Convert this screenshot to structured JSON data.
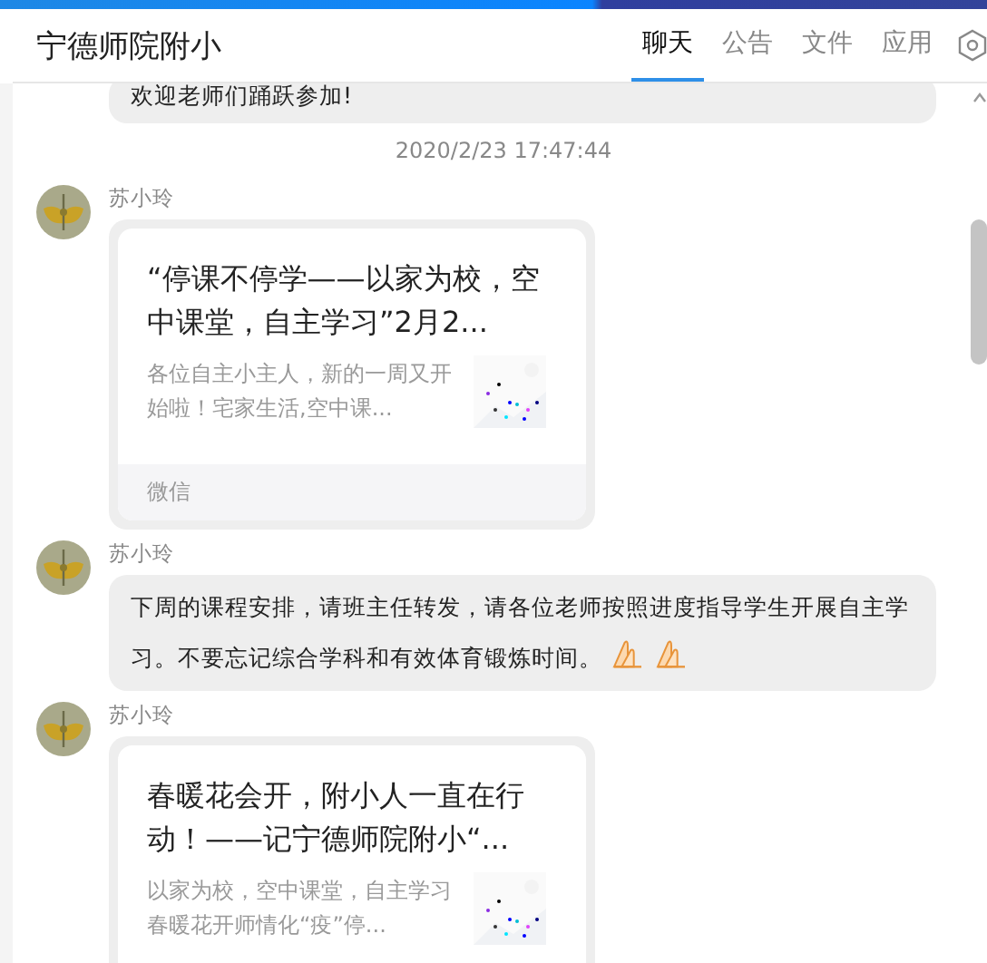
{
  "header": {
    "title": "宁德师院附小",
    "tabs": [
      {
        "label": "聊天",
        "selected": true
      },
      {
        "label": "公告",
        "selected": false
      },
      {
        "label": "文件",
        "selected": false
      },
      {
        "label": "应用",
        "selected": false
      }
    ]
  },
  "messages": [
    {
      "kind": "text",
      "text": "欢迎老师们踊跃参加!"
    },
    {
      "kind": "time",
      "text": "2020/2/23 17:47:44"
    },
    {
      "kind": "card",
      "sender": "苏小玲",
      "title": "“停课不停学——以家为校，空中课堂，自主学习”2月2...",
      "description": "各位自主小主人，新的一周又开始啦！宅家生活,空中课...",
      "source": "微信"
    },
    {
      "kind": "text",
      "sender": "苏小玲",
      "text": "下周的课程安排，请班主任转发，请各位老师按照进度指导学生开展自主学习。不要忘记综合学科和有效体育锻炼时间。",
      "emojis": [
        {
          "kind": "praying-hands"
        },
        {
          "kind": "praying-hands"
        }
      ]
    },
    {
      "kind": "card",
      "sender": "苏小玲",
      "title": "春暖花会开，附小人一直在行动！——记宁德师院附小“...",
      "description": "以家为校，空中课堂，自主学习春暖花开师情化“疫”停..."
    }
  ]
}
